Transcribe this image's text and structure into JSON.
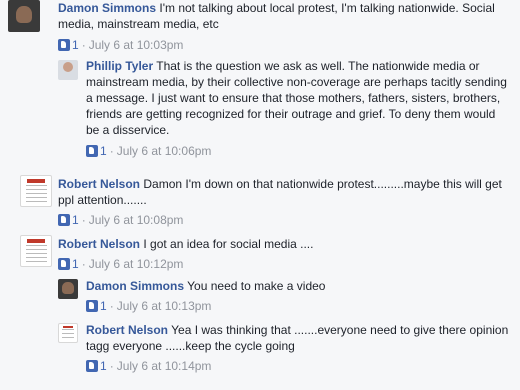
{
  "comments": [
    {
      "author": "Damon Simmons",
      "text": "I'm not talking about local protest, I'm talking nationwide. Social media, mainstream media, etc",
      "likes": "1",
      "separator": "·",
      "time": "July 6 at 10:03pm",
      "avatar": "portrait-photo"
    },
    {
      "author": "Phillip Tyler",
      "text": "That is the question we ask as well. The nationwide media or mainstream media, by their collective non-coverage are perhaps tacitly sending a message. I just want to ensure that those mothers, fathers, sisters, brothers, friends are getting recognized for their outrage and grief. To deny them would be a disservice.",
      "likes": "1",
      "separator": "·",
      "time": "July 6 at 10:06pm",
      "avatar": "portrait-photo"
    },
    {
      "author": "Robert Nelson",
      "text": "Damon I'm down on that nationwide protest.........maybe this will get ppl attention.......",
      "likes": "1",
      "separator": "·",
      "time": "July 6 at 10:08pm",
      "avatar": "document-thumbnail"
    },
    {
      "author": "Robert Nelson",
      "text": "I got an idea for social media ....",
      "likes": "1",
      "separator": "·",
      "time": "July 6 at 10:12pm",
      "avatar": "document-thumbnail"
    },
    {
      "author": "Damon Simmons",
      "text": "You need to make a video",
      "likes": "1",
      "separator": "·",
      "time": "July 6 at 10:13pm",
      "avatar": "portrait-photo"
    },
    {
      "author": "Robert Nelson",
      "text": "Yea I was thinking that .......everyone need to give there opinion tagg everyone ......keep the cycle going",
      "likes": "1",
      "separator": "·",
      "time": "July 6 at 10:14pm",
      "avatar": "document-thumbnail"
    }
  ],
  "colors": {
    "name": "#365899",
    "text": "#1d2129",
    "meta": "#90949c",
    "like": "#4267b2",
    "background": "#f6f7f9"
  },
  "icons": {
    "like": "thumbs-up-icon"
  }
}
